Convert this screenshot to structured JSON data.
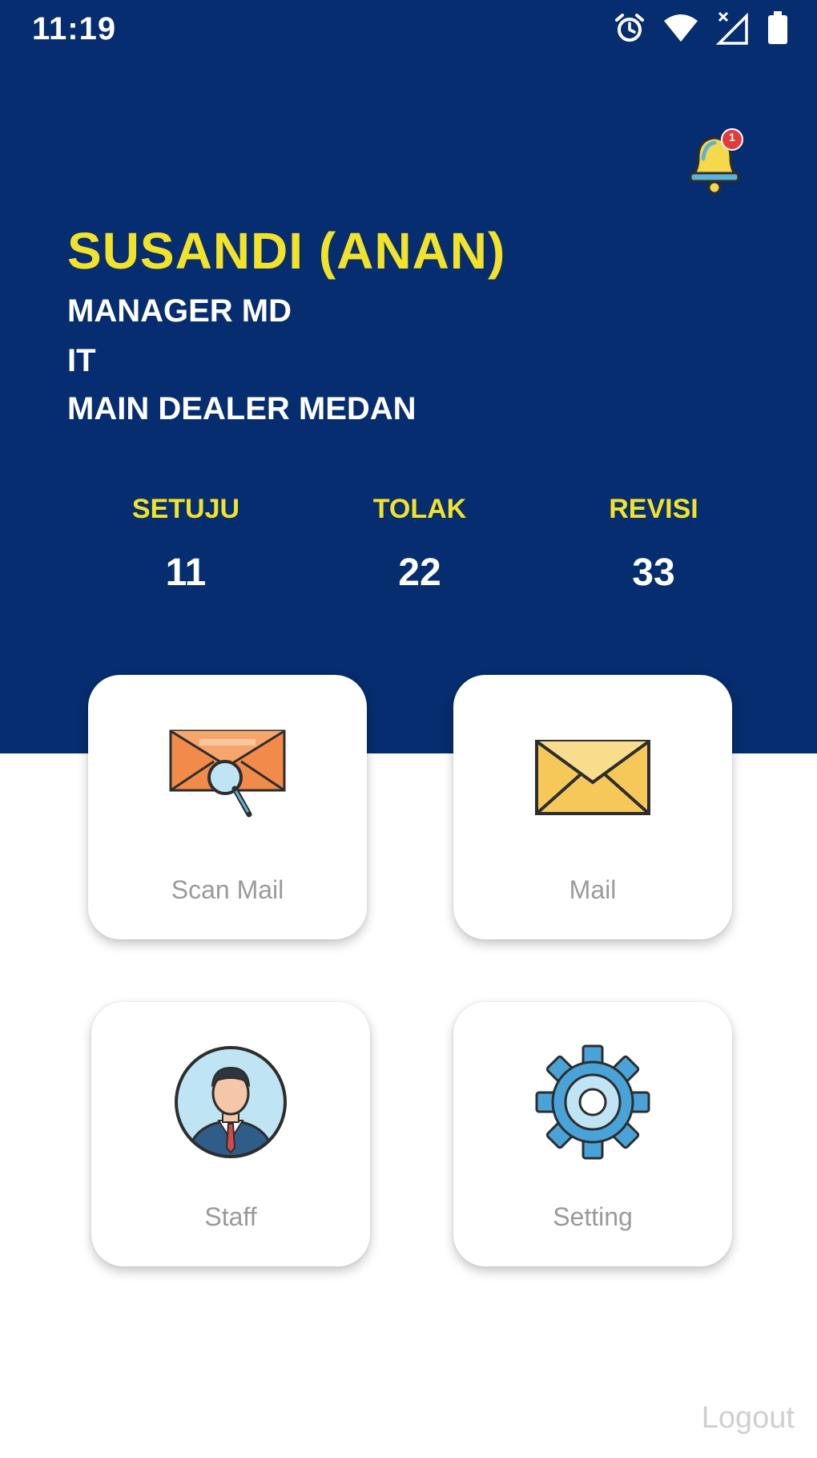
{
  "status_bar": {
    "time": "11:19"
  },
  "notification": {
    "badge": "1",
    "icon": "bell-icon"
  },
  "profile": {
    "name": "SUSANDI (ANAN)",
    "position": "MANAGER MD",
    "department": "IT",
    "company": "MAIN DEALER MEDAN"
  },
  "stats": [
    {
      "label": "SETUJU",
      "value": "11"
    },
    {
      "label": "TOLAK",
      "value": "22"
    },
    {
      "label": "REVISI",
      "value": "33"
    }
  ],
  "menu": [
    {
      "label": "Scan Mail",
      "icon": "scan-mail-icon"
    },
    {
      "label": "Mail",
      "icon": "mail-envelope-icon"
    },
    {
      "label": "Staff",
      "icon": "staff-avatar-icon"
    },
    {
      "label": "Setting",
      "icon": "gear-icon"
    }
  ],
  "logout_label": "Logout",
  "colors": {
    "header_bg": "#062d6f",
    "accent_yellow": "#f2e32a",
    "card_label": "#9a9a9a",
    "logout": "#cfcfcf"
  }
}
